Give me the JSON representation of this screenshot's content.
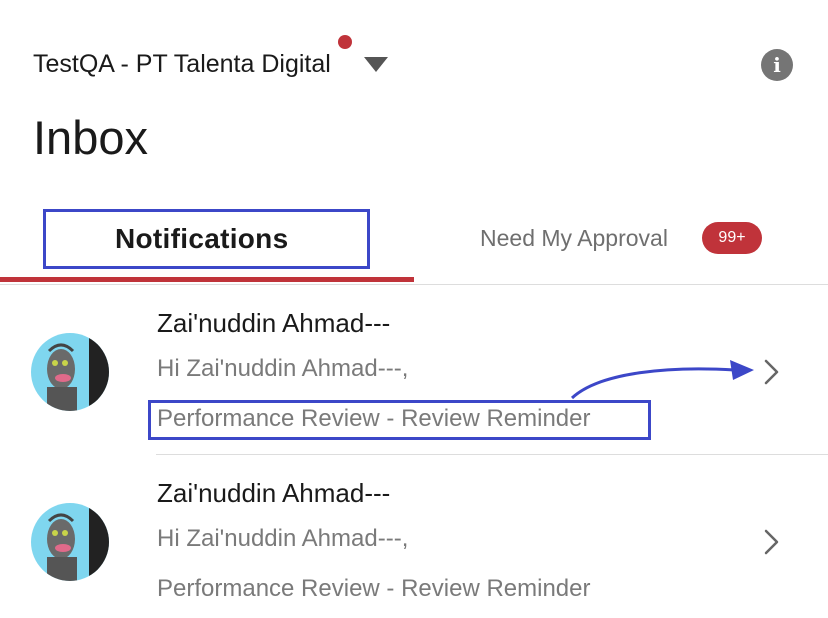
{
  "header": {
    "company_name": "TestQA - PT Talenta Digital",
    "company_dot_color": "#c0333a",
    "dropdown_icon": "caret-down-icon",
    "info_icon": "info-icon",
    "info_glyph": "i"
  },
  "page": {
    "title": "Inbox"
  },
  "tabs": [
    {
      "label": "Notifications",
      "active": true
    },
    {
      "label": "Need My Approval",
      "badge": "99+"
    }
  ],
  "colors": {
    "accent": "#c0333a",
    "annotation": "#3c47c8",
    "avatar_bg": "#7fd6ef"
  },
  "notifications": [
    {
      "sender": "Zai'nuddin Ahmad---",
      "greeting": "Hi Zai'nuddin Ahmad---,",
      "subject": "Performance Review - Review Reminder"
    },
    {
      "sender": "Zai'nuddin Ahmad---",
      "greeting": "Hi Zai'nuddin Ahmad---,",
      "subject": "Performance Review - Review Reminder"
    }
  ]
}
